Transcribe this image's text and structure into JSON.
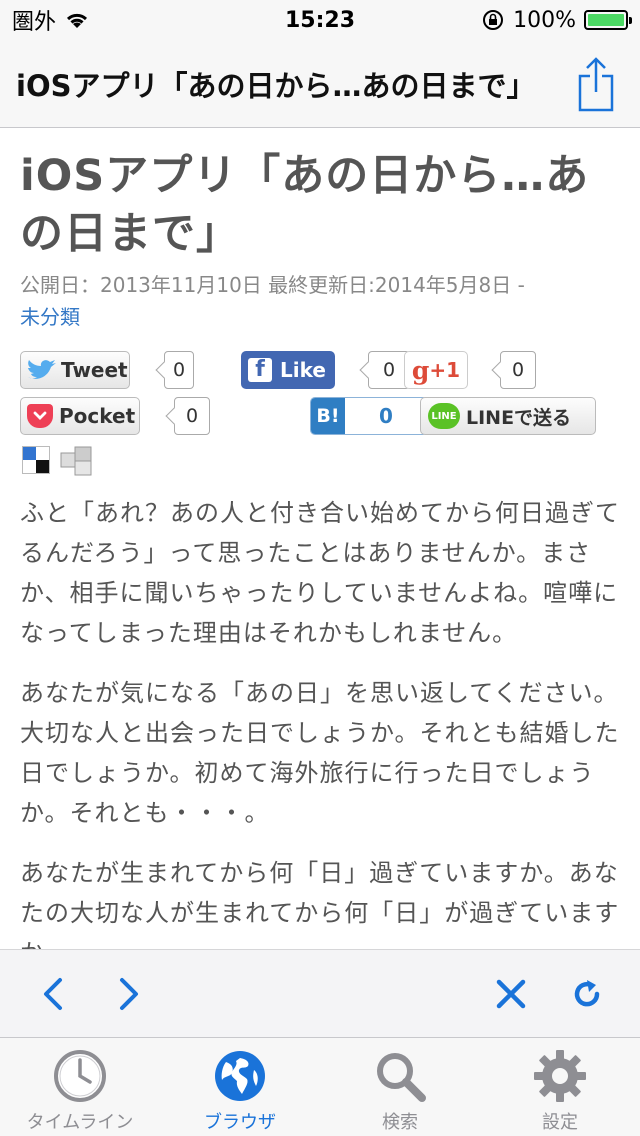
{
  "status_bar": {
    "carrier": "圏外",
    "time": "15:23",
    "battery": "100%",
    "battery_level": 1.0
  },
  "nav": {
    "title": "iOSアプリ「あの日から…あの日まで」"
  },
  "article": {
    "title": "iOSアプリ「あの日から…あの日まで」",
    "published": "公開日：2013年11月10日 最終更新日:2014年5月8日",
    "separator": " -",
    "category": "未分類",
    "social": {
      "tweet": {
        "label": "Tweet",
        "count": "0"
      },
      "like": {
        "label": "Like",
        "count": "0"
      },
      "gplus": {
        "label": "+1",
        "count": "0"
      },
      "pocket": {
        "label": "Pocket",
        "count": "0"
      },
      "hatena": {
        "label": "B!",
        "count": "0"
      },
      "line": {
        "label": "LINEで送る"
      }
    },
    "paragraphs": [
      "ふと「あれ？あの人と付き合い始めてから何日過ぎてるんだろう」って思ったことはありませんか。まさか、相手に聞いちゃったりしていませんよね。喧嘩になってしまった理由はそれかもしれません。",
      "あなたが気になる「あの日」を思い返してください。大切な人と出会った日でしょうか。それとも結婚した日でしょうか。初めて海外旅行に行った日でしょうか。それとも・・・。",
      "あなたが生まれてから何「日」過ぎていますか。あなたの大切な人が生まれてから何「日」が過ぎていますか。"
    ]
  },
  "tabs": [
    {
      "label": "タイムライン",
      "icon": "clock-icon",
      "active": false
    },
    {
      "label": "ブラウザ",
      "icon": "globe-icon",
      "active": true
    },
    {
      "label": "検索",
      "icon": "search-icon",
      "active": false
    },
    {
      "label": "設定",
      "icon": "gear-icon",
      "active": false
    }
  ],
  "colors": {
    "accent": "#1a73d9",
    "tab_inactive": "#8e8e93",
    "battery": "#4cd964"
  }
}
